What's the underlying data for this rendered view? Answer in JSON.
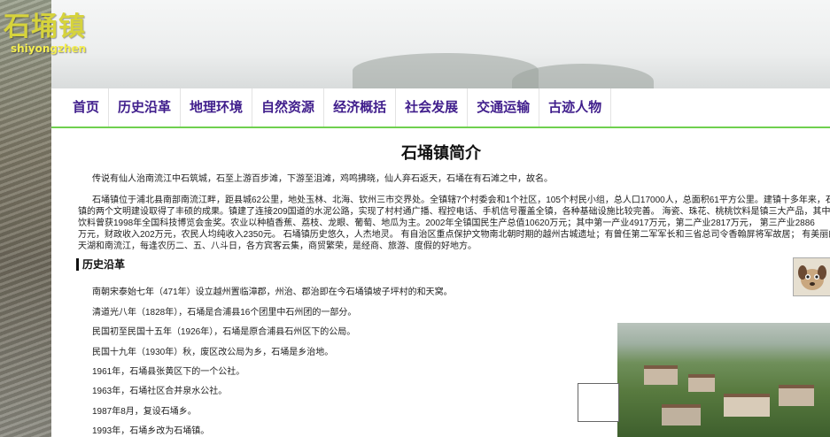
{
  "logo": {
    "cn": "石埇镇",
    "en": "shiyongzhen"
  },
  "nav": [
    "首页",
    "历史沿革",
    "地理环境",
    "自然资源",
    "经济概括",
    "社会发展",
    "交通运输",
    "古迹人物"
  ],
  "page": {
    "title": "石埇镇简介",
    "intro": "传说有仙人治南流江中石筑城，石至上游百步滩，下游至沮滩，鸡鸣拂晓，仙人弃石返天，石埇在有石滩之中，故名。",
    "body_lines": [
      "石埇镇位于浦北县南部南流江畔，距县城62公里，地处玉林、北海、钦州三市交界处。全镇辖7个村委会和1个社区，105个村民小组，总人口17000人，总面积61平方公里。建镇十多年来，石埇",
      "镇的两个文明建设取得了丰硕的成果。镇建了连接209国道的水泥公路，实现了村村通广播、程控电话、手机信号覆盖全镇，各种基础设施比较完善。 海瓷、珠花、桃桃饮料是镇三大产品，其中桃桃",
      "饮料曾获1998年全国科技博览会金奖。农业以种植香蕉、荔枝、龙眼、葡萄、地瓜为主。2002年全镇国民生产总值10620万元；其中第一产业4917万元，第二产业2817万元， 第三产业2886",
      "万元，财政收入202万元，农民人均纯收入2350元。 石埇镇历史悠久，人杰地灵。 有自治区重点保护文物南北朝时期的越州古城遗址；有曾任第二军军长和三省总司令香翰屏将军故居； 有美丽的越州",
      "天湖和南流江，每逢农历二、五、八斗日，各方宾客云集，商贸繁荣，是经商、旅游、度假的好地方。"
    ],
    "section_title": "历史沿革",
    "events": [
      "南朝宋泰始七年（471年）设立越州置临漳郡，州治、郡治即在今石埇镇坡子坪村的和天窝。",
      "清道光八年（1828年），石埇是合浦县16个团里中石州团的一部分。",
      "民国初至民国十五年（1926年），石埇是原合浦县石州区下的公局。",
      "民国十九年（1930年）秋，废区改公局为乡，石埇是乡治地。",
      "1961年，石埇县张黄区下的一个公社。",
      "1963年，石埇社区合并泉水公社。",
      "1987年8月，复设石埇乡。",
      "1993年，石埇乡改为石埇镇。"
    ]
  },
  "colors": {
    "logo": "#d6d33c",
    "nav_text": "#401e8c",
    "nav_border": "#6fd04f"
  }
}
